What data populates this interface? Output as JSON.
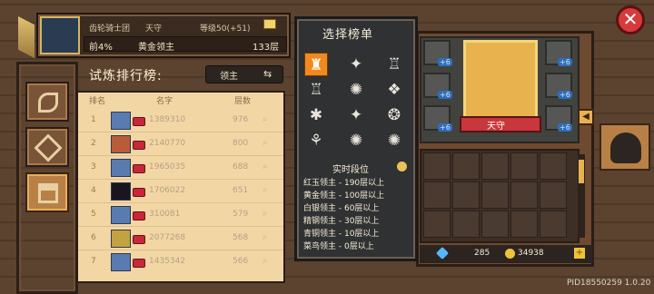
{
  "player": {
    "guild": "齿轮骑士团",
    "name": "天守",
    "level": "等级50(+51)",
    "percent": "前4%",
    "tier": "黄金领主",
    "floor": "133层"
  },
  "header": {
    "title": "试炼排行榜:",
    "selector_label": "领主",
    "swap_icon": "⇆"
  },
  "columns": {
    "rank": "排名",
    "name": "名字",
    "floor": "层数"
  },
  "rows": [
    {
      "rank": "1",
      "name": "1389310",
      "floor": "976"
    },
    {
      "rank": "2",
      "name": "2140770",
      "floor": "800"
    },
    {
      "rank": "3",
      "name": "1965035",
      "floor": "688"
    },
    {
      "rank": "4",
      "name": "1706022",
      "floor": "651"
    },
    {
      "rank": "5",
      "name": "310081",
      "floor": "579"
    },
    {
      "rank": "6",
      "name": "2077268",
      "floor": "568"
    },
    {
      "rank": "7",
      "name": "1435342",
      "floor": "566"
    }
  ],
  "popup": {
    "title": "选择榜单",
    "icons": [
      "♜",
      "✦",
      "♖",
      "♖",
      "✺",
      "❖",
      "✱",
      "✦",
      "❂",
      "⚘",
      "✺",
      "✺"
    ],
    "realtime_title": "实时段位",
    "tiers": [
      "红玉领主 - 190层以上",
      "黄金领主 - 100层以上",
      "白银领主 - 60层以上",
      "精钢领主 - 30层以上",
      "青铜领主 - 10层以上",
      "菜鸟领主 - 0层以上"
    ]
  },
  "hero": {
    "name": "天守",
    "plus_labels": [
      "+6",
      "+6",
      "+6",
      "+6",
      "+6",
      "+6"
    ]
  },
  "currency": {
    "gems": "285",
    "coins": "34938"
  },
  "ui": {
    "close": "✕",
    "arrow": "◀",
    "coin_plus": "+",
    "pid": "PID18550259 1.0.20"
  },
  "icons": {
    "sidebar": [
      "feather-icon",
      "diamond-icon",
      "podium-icon"
    ],
    "accent": "#f08a1c"
  }
}
